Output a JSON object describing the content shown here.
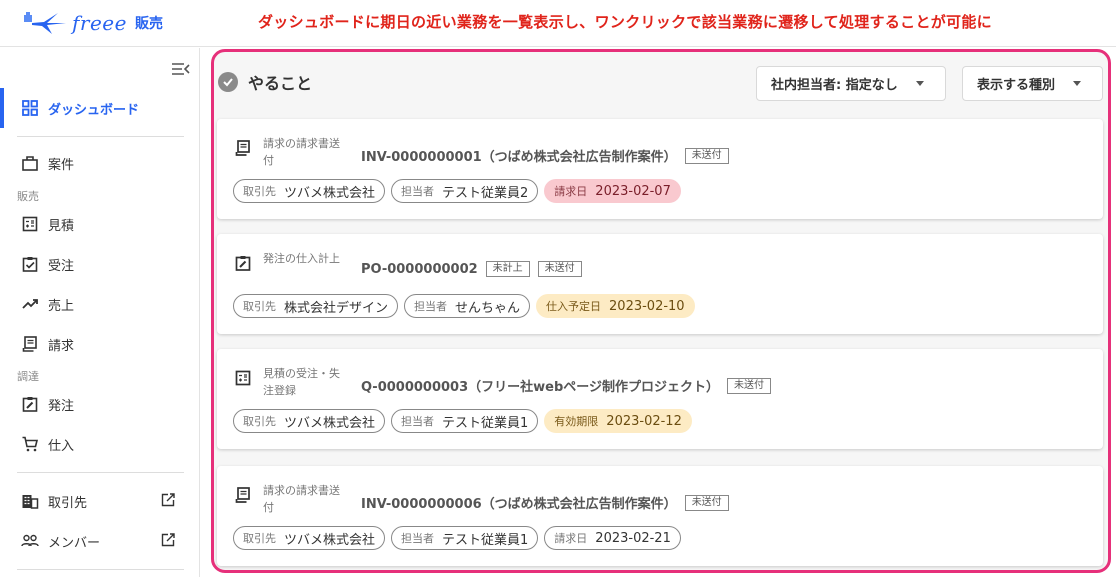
{
  "app": {
    "brand": "freee",
    "product": "販売"
  },
  "annotation": "ダッシュボードに期日の近い業務を一覧表示し、ワンクリックで該当業務に遷移して処理することが可能に",
  "colors": {
    "brand": "#2864f0",
    "annotation": "#e0241b",
    "highlight": "#e6307a",
    "chip_red": "#f9c9cf",
    "chip_yellow": "#fdebc4"
  },
  "sidebar": {
    "collapse_icon": "menu-collapse-icon",
    "items": [
      {
        "label": "ダッシュボード",
        "icon": "dashboard-icon",
        "active": true
      },
      {
        "label": "案件",
        "icon": "briefcase-icon"
      },
      {
        "label": "見積",
        "icon": "calculator-icon"
      },
      {
        "label": "受注",
        "icon": "clipboard-check-icon"
      },
      {
        "label": "売上",
        "icon": "trending-up-icon"
      },
      {
        "label": "請求",
        "icon": "receipt-icon"
      },
      {
        "label": "発注",
        "icon": "clipboard-edit-icon"
      },
      {
        "label": "仕入",
        "icon": "cart-icon"
      },
      {
        "label": "取引先",
        "icon": "building-icon",
        "external": true
      },
      {
        "label": "メンバー",
        "icon": "people-icon",
        "external": true
      }
    ],
    "sections": {
      "sales": "販売",
      "procurement": "調達"
    }
  },
  "todo": {
    "title": "やること",
    "filters": {
      "assignee": "社内担当者: 指定なし",
      "type": "表示する種別"
    },
    "cards": [
      {
        "kind": "請求の請求書送付",
        "icon": "receipt-icon",
        "title": "INV-0000000001（つばめ株式会社広告制作案件）",
        "tags": [
          "未送付"
        ],
        "client_label": "取引先",
        "client": "ツバメ株式会社",
        "assignee_label": "担当者",
        "assignee": "テスト従業員2",
        "date_label": "請求日",
        "date": "2023-02-07",
        "date_style": "red"
      },
      {
        "kind": "発注の仕入計上",
        "icon": "clipboard-edit-icon",
        "title": "PO-0000000002",
        "tags": [
          "未計上",
          "未送付"
        ],
        "client_label": "取引先",
        "client": "株式会社デザイン",
        "assignee_label": "担当者",
        "assignee": "せんちゃん",
        "date_label": "仕入予定日",
        "date": "2023-02-10",
        "date_style": "yellow"
      },
      {
        "kind": "見積の受注・失注登録",
        "icon": "calculator-icon",
        "title": "Q-0000000003（フリー社webページ制作プロジェクト）",
        "tags": [
          "未送付"
        ],
        "client_label": "取引先",
        "client": "ツバメ株式会社",
        "assignee_label": "担当者",
        "assignee": "テスト従業員1",
        "date_label": "有効期限",
        "date": "2023-02-12",
        "date_style": "yellow"
      },
      {
        "kind": "請求の請求書送付",
        "icon": "receipt-icon",
        "title": "INV-0000000006（つばめ株式会社広告制作案件）",
        "tags": [
          "未送付"
        ],
        "client_label": "取引先",
        "client": "ツバメ株式会社",
        "assignee_label": "担当者",
        "assignee": "テスト従業員1",
        "date_label": "請求日",
        "date": "2023-02-21",
        "date_style": "plain"
      }
    ]
  }
}
